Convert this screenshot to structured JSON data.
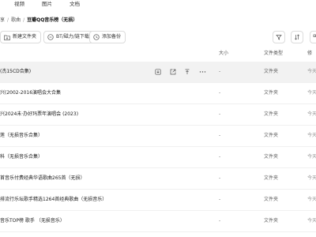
{
  "tabs": [
    "视频",
    "图片",
    "文档"
  ],
  "breadcrumb": {
    "items": [
      "享",
      "歌曲"
    ],
    "current": "豆瓣QQ音乐榜（无损）"
  },
  "toolbar": {
    "new_folder": "新建文件夹",
    "bt_download": "BT/磁力/链下载",
    "add_backup": "添加备份"
  },
  "table": {
    "columns": {
      "size": "大小",
      "type": "文件类型",
      "modified": "修改"
    },
    "rows": [
      {
        "name": "(杰15CD合集)",
        "size": "-",
        "type": "文件夹",
        "modified": "今天"
      },
      {
        "name": "兴(2002-2016演唱会大合集",
        "size": "-",
        "type": "文件夹",
        "modified": "今天"
      },
      {
        "name": "兴2024未·办好玛票年演唱会 (2023)",
        "size": "-",
        "type": "文件夹",
        "modified": "今天"
      },
      {
        "name": "莲（无损音乐合集）",
        "size": "-",
        "type": "文件夹",
        "modified": "今天"
      },
      {
        "name": "科（无损音乐合集）",
        "size": "-",
        "type": "文件夹",
        "modified": "今天"
      },
      {
        "name": "首音乐付费经典华语歌曲265首（无损）",
        "size": "-",
        "type": "文件夹",
        "modified": "今天"
      },
      {
        "name": "排流行乐坛歌手精选1264首经典歌曲（无损音乐）",
        "size": "-",
        "type": "文件夹",
        "modified": "今天"
      },
      {
        "name": "音乐TOP榜 歌手 （无损音乐）",
        "size": "-",
        "type": "文件夹",
        "modified": "今天"
      }
    ]
  }
}
